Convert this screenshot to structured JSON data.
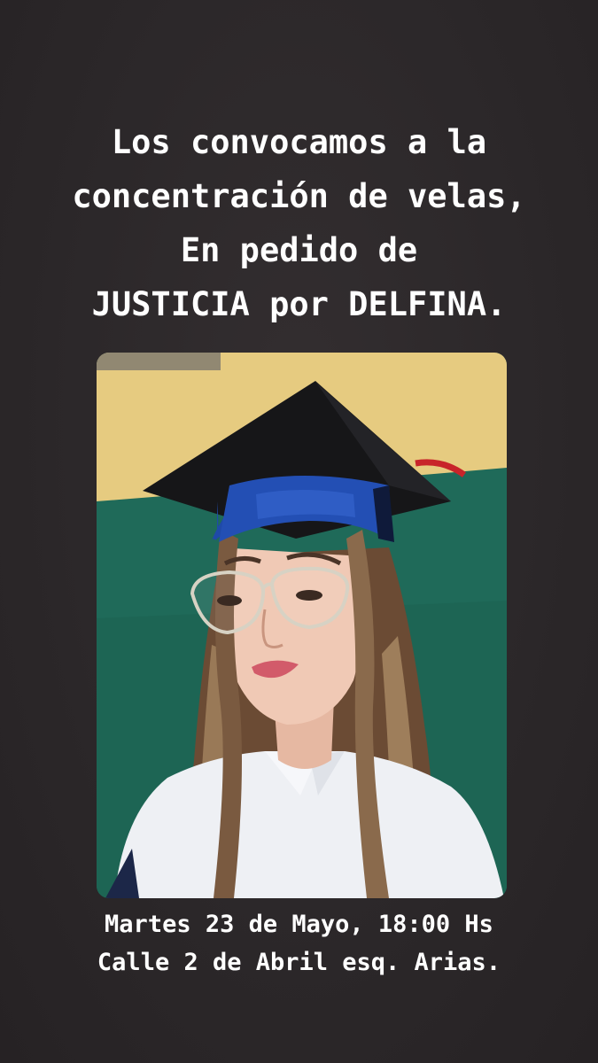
{
  "headline": {
    "lines": [
      "Los convocamos a la",
      "concentración de velas,",
      "En pedido de",
      "JUSTICIA por DELFINA."
    ]
  },
  "details": {
    "date_time": "Martes 23 de Mayo, 18:00 Hs",
    "location": "Calle 2 de Abril esq. Arias."
  },
  "colors": {
    "background": "#2c282a",
    "text": "#ffffff",
    "wall_yellow": "#e8cd82",
    "wall_green": "#1f6a59",
    "cap_black": "#161618",
    "cap_band_blue": "#1f4aa8",
    "tassel_red": "#c8242a"
  }
}
